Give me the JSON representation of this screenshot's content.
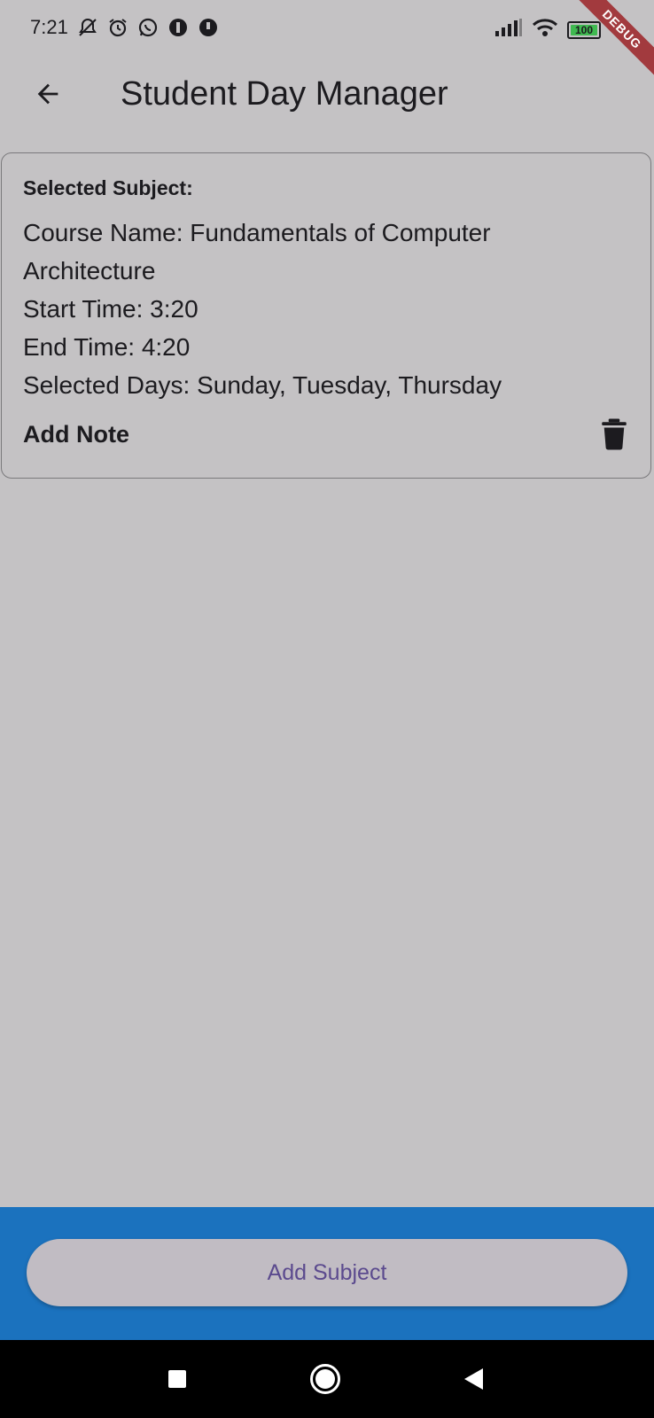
{
  "status_bar": {
    "time": "7:21",
    "battery_level": "100",
    "left_icons": [
      "muted-bell-icon",
      "alarm-icon",
      "whatsapp-icon",
      "app-notification-icon",
      "app-notification-icon"
    ],
    "right_icons": [
      "signal-icon",
      "wifi-icon",
      "battery-icon",
      "charging-icon"
    ],
    "debug_banner": "DEBUG"
  },
  "app_bar": {
    "title": "Student Day Manager",
    "back_icon": "arrow-back-icon"
  },
  "card": {
    "heading": "Selected Subject:",
    "course_name_line": "Course Name: Fundamentals of Computer Architecture",
    "start_time_line": "Start Time: 3:20",
    "end_time_line": "End Time: 4:20",
    "selected_days_line": "Selected Days: Sunday, Tuesday, Thursday",
    "add_note_label": "Add Note",
    "delete_icon": "trash-icon"
  },
  "bottom_bar": {
    "add_subject_label": "Add Subject"
  },
  "nav_bar": {
    "icons": [
      "recents-square-icon",
      "home-circle-icon",
      "back-triangle-icon"
    ]
  },
  "colors": {
    "background": "#c4c2c4",
    "bottom_bar": "#1b72be",
    "button_text": "#5b4a8e",
    "debug_ribbon": "#a23a3e"
  }
}
